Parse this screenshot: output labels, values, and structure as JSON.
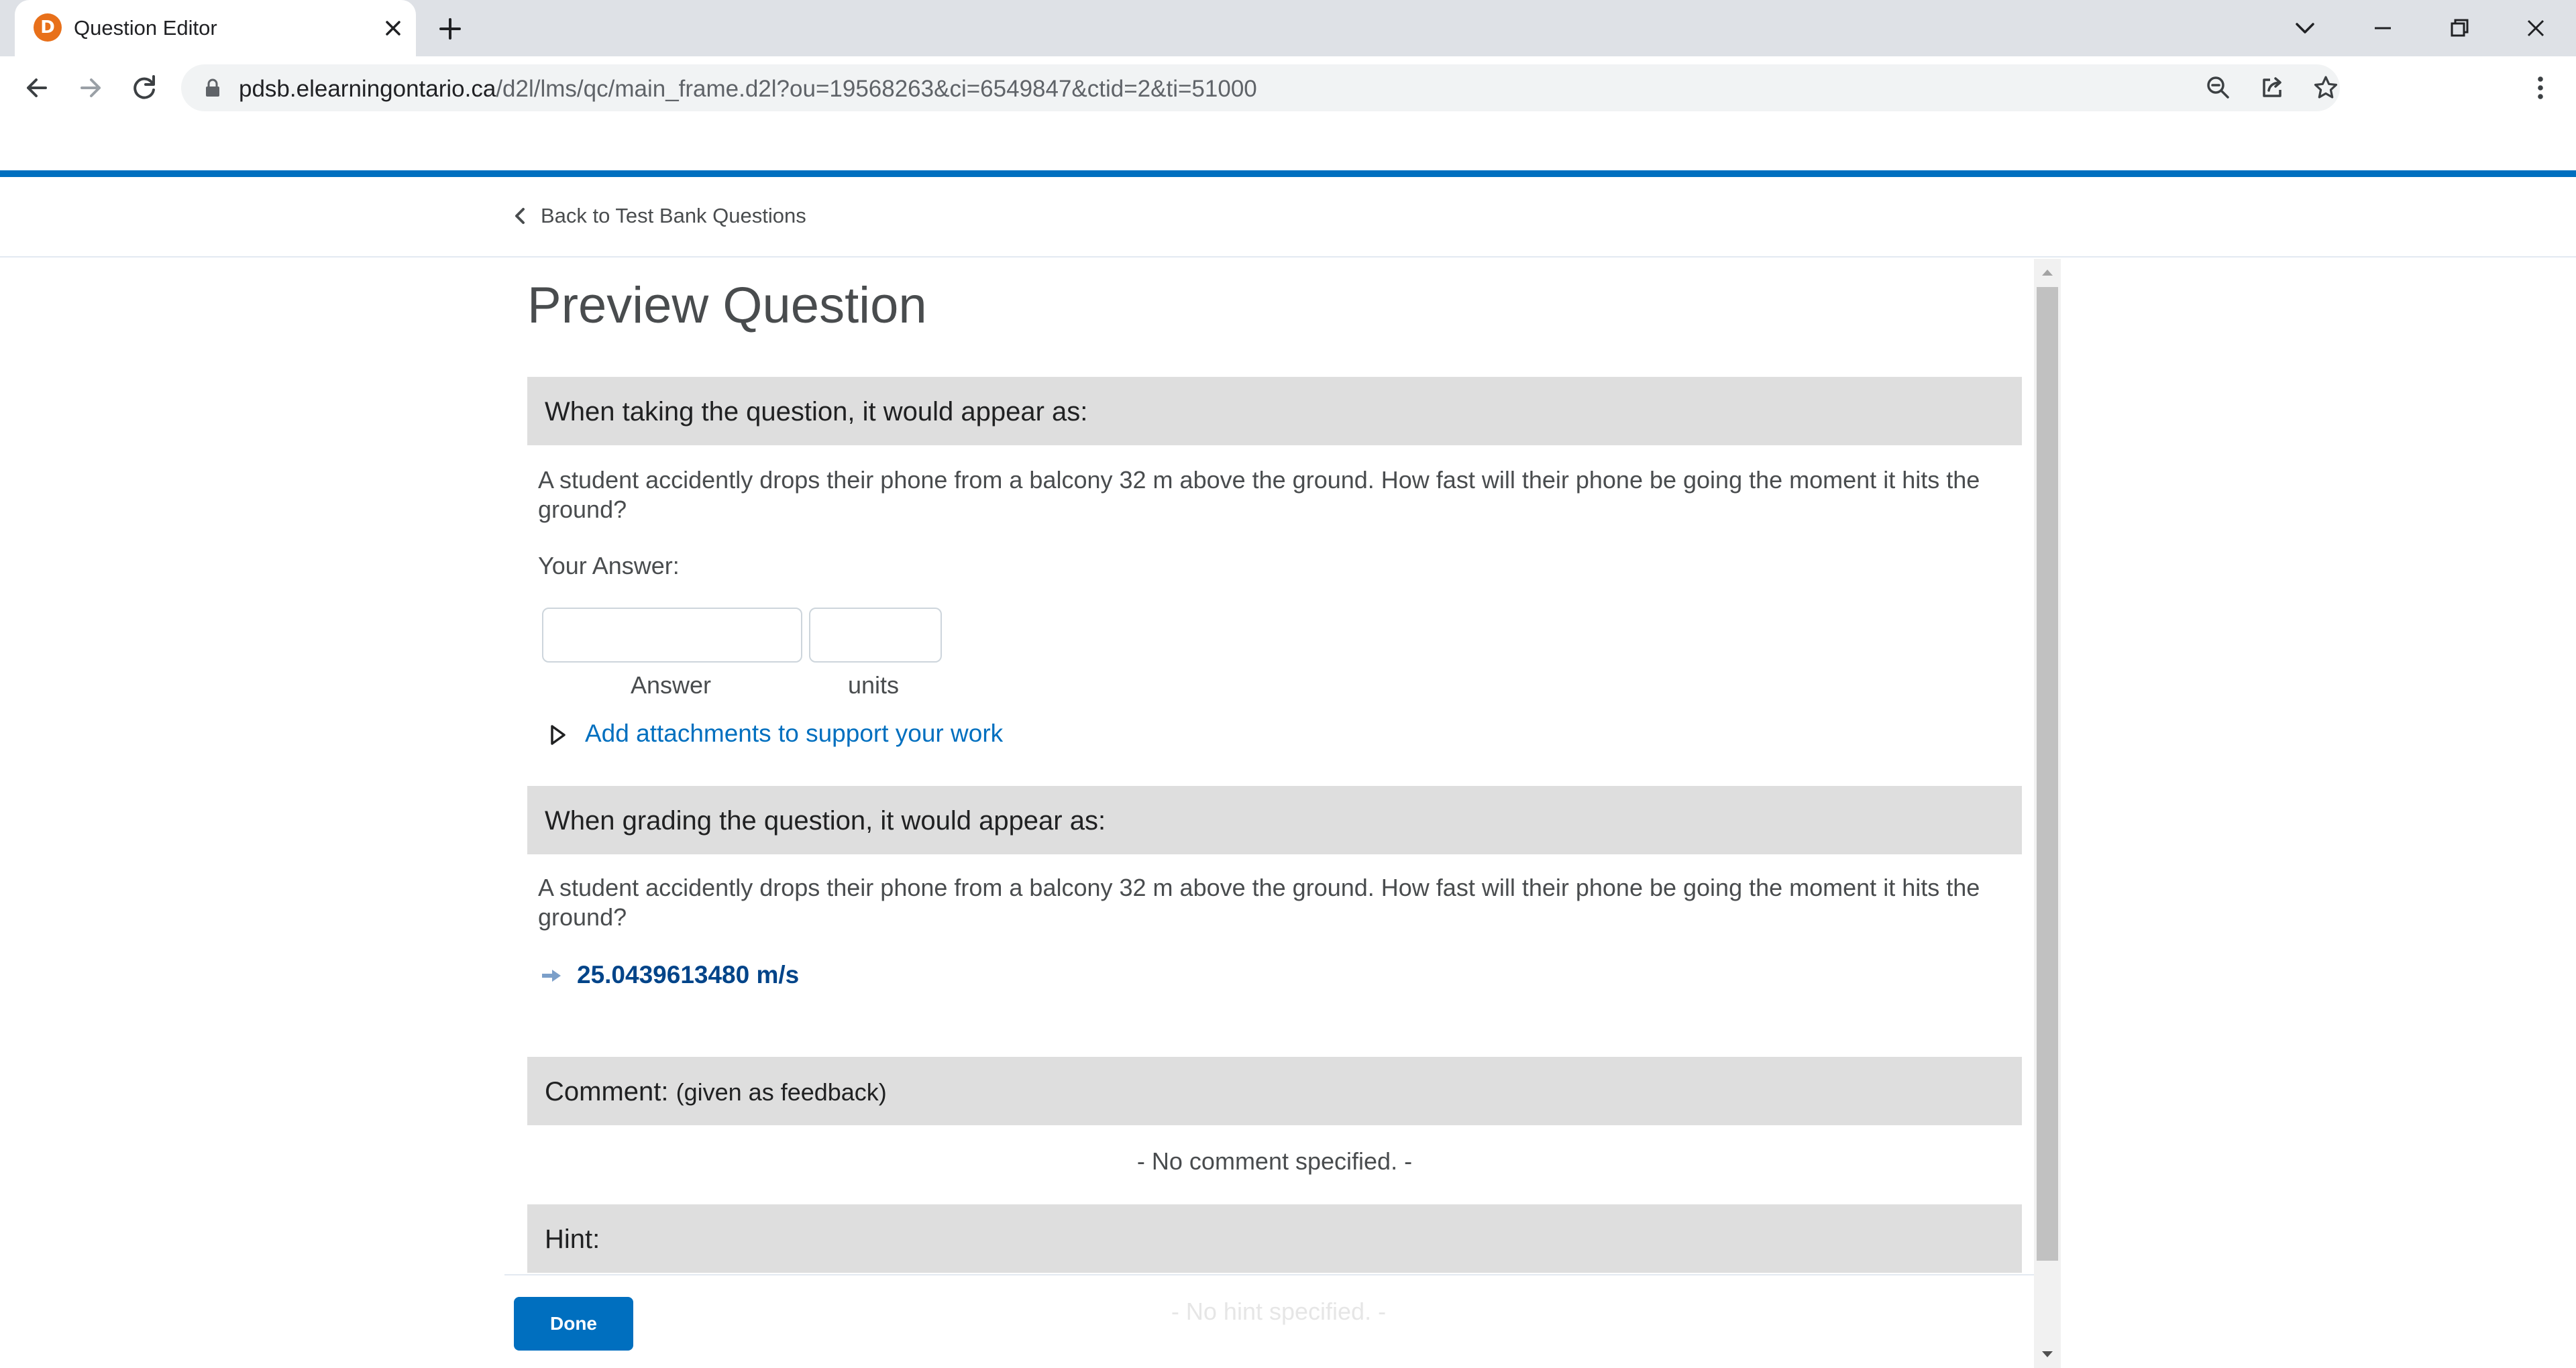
{
  "browser": {
    "tab_title": "Question Editor",
    "url_host": "pdsb.elearningontario.ca",
    "url_path": "/d2l/lms/qc/main_frame.d2l?ou=19568263&ci=6549847&ctid=2&ti=51000"
  },
  "header": {
    "back_link": "Back to Test Bank Questions"
  },
  "page": {
    "title": "Preview Question"
  },
  "taking": {
    "heading": "When taking the question, it would appear as:",
    "question": "A student accidently drops their phone from a balcony 32 m above the ground. How fast will their phone be going the moment it hits the ground?",
    "your_answer_label": "Your Answer:",
    "answer_value": "",
    "units_value": "",
    "answer_caption": "Answer",
    "units_caption": "units",
    "attachments_link": "Add attachments to support your work"
  },
  "grading": {
    "heading": "When grading the question, it would appear as:",
    "question": "A student accidently drops their phone from a balcony 32 m above the ground. How fast will their phone be going the moment it hits the ground?",
    "correct_answer": "25.0439613480 m/s"
  },
  "comment": {
    "heading": "Comment:",
    "heading_sub": "(given as feedback)",
    "empty_text": "- No comment specified. -"
  },
  "hint": {
    "heading": "Hint:",
    "empty_text": "- No hint specified. -"
  },
  "footer": {
    "done_label": "Done"
  },
  "colors": {
    "accent": "#006fbf",
    "section_bg": "#dedede",
    "answer_text": "#004489",
    "favicon": "#e8701a"
  },
  "icons": {
    "favicon": "d2l-logo-icon",
    "tab_close": "close-icon",
    "new_tab": "plus-icon",
    "back": "arrow-left-icon",
    "forward": "arrow-right-icon",
    "reload": "reload-icon",
    "lock": "lock-icon",
    "zoom": "zoom-out-icon",
    "share": "share-icon",
    "bookmark": "star-icon",
    "menu": "kebab-icon",
    "attachments": "triangle-right-icon",
    "correct": "arrow-right-icon"
  }
}
